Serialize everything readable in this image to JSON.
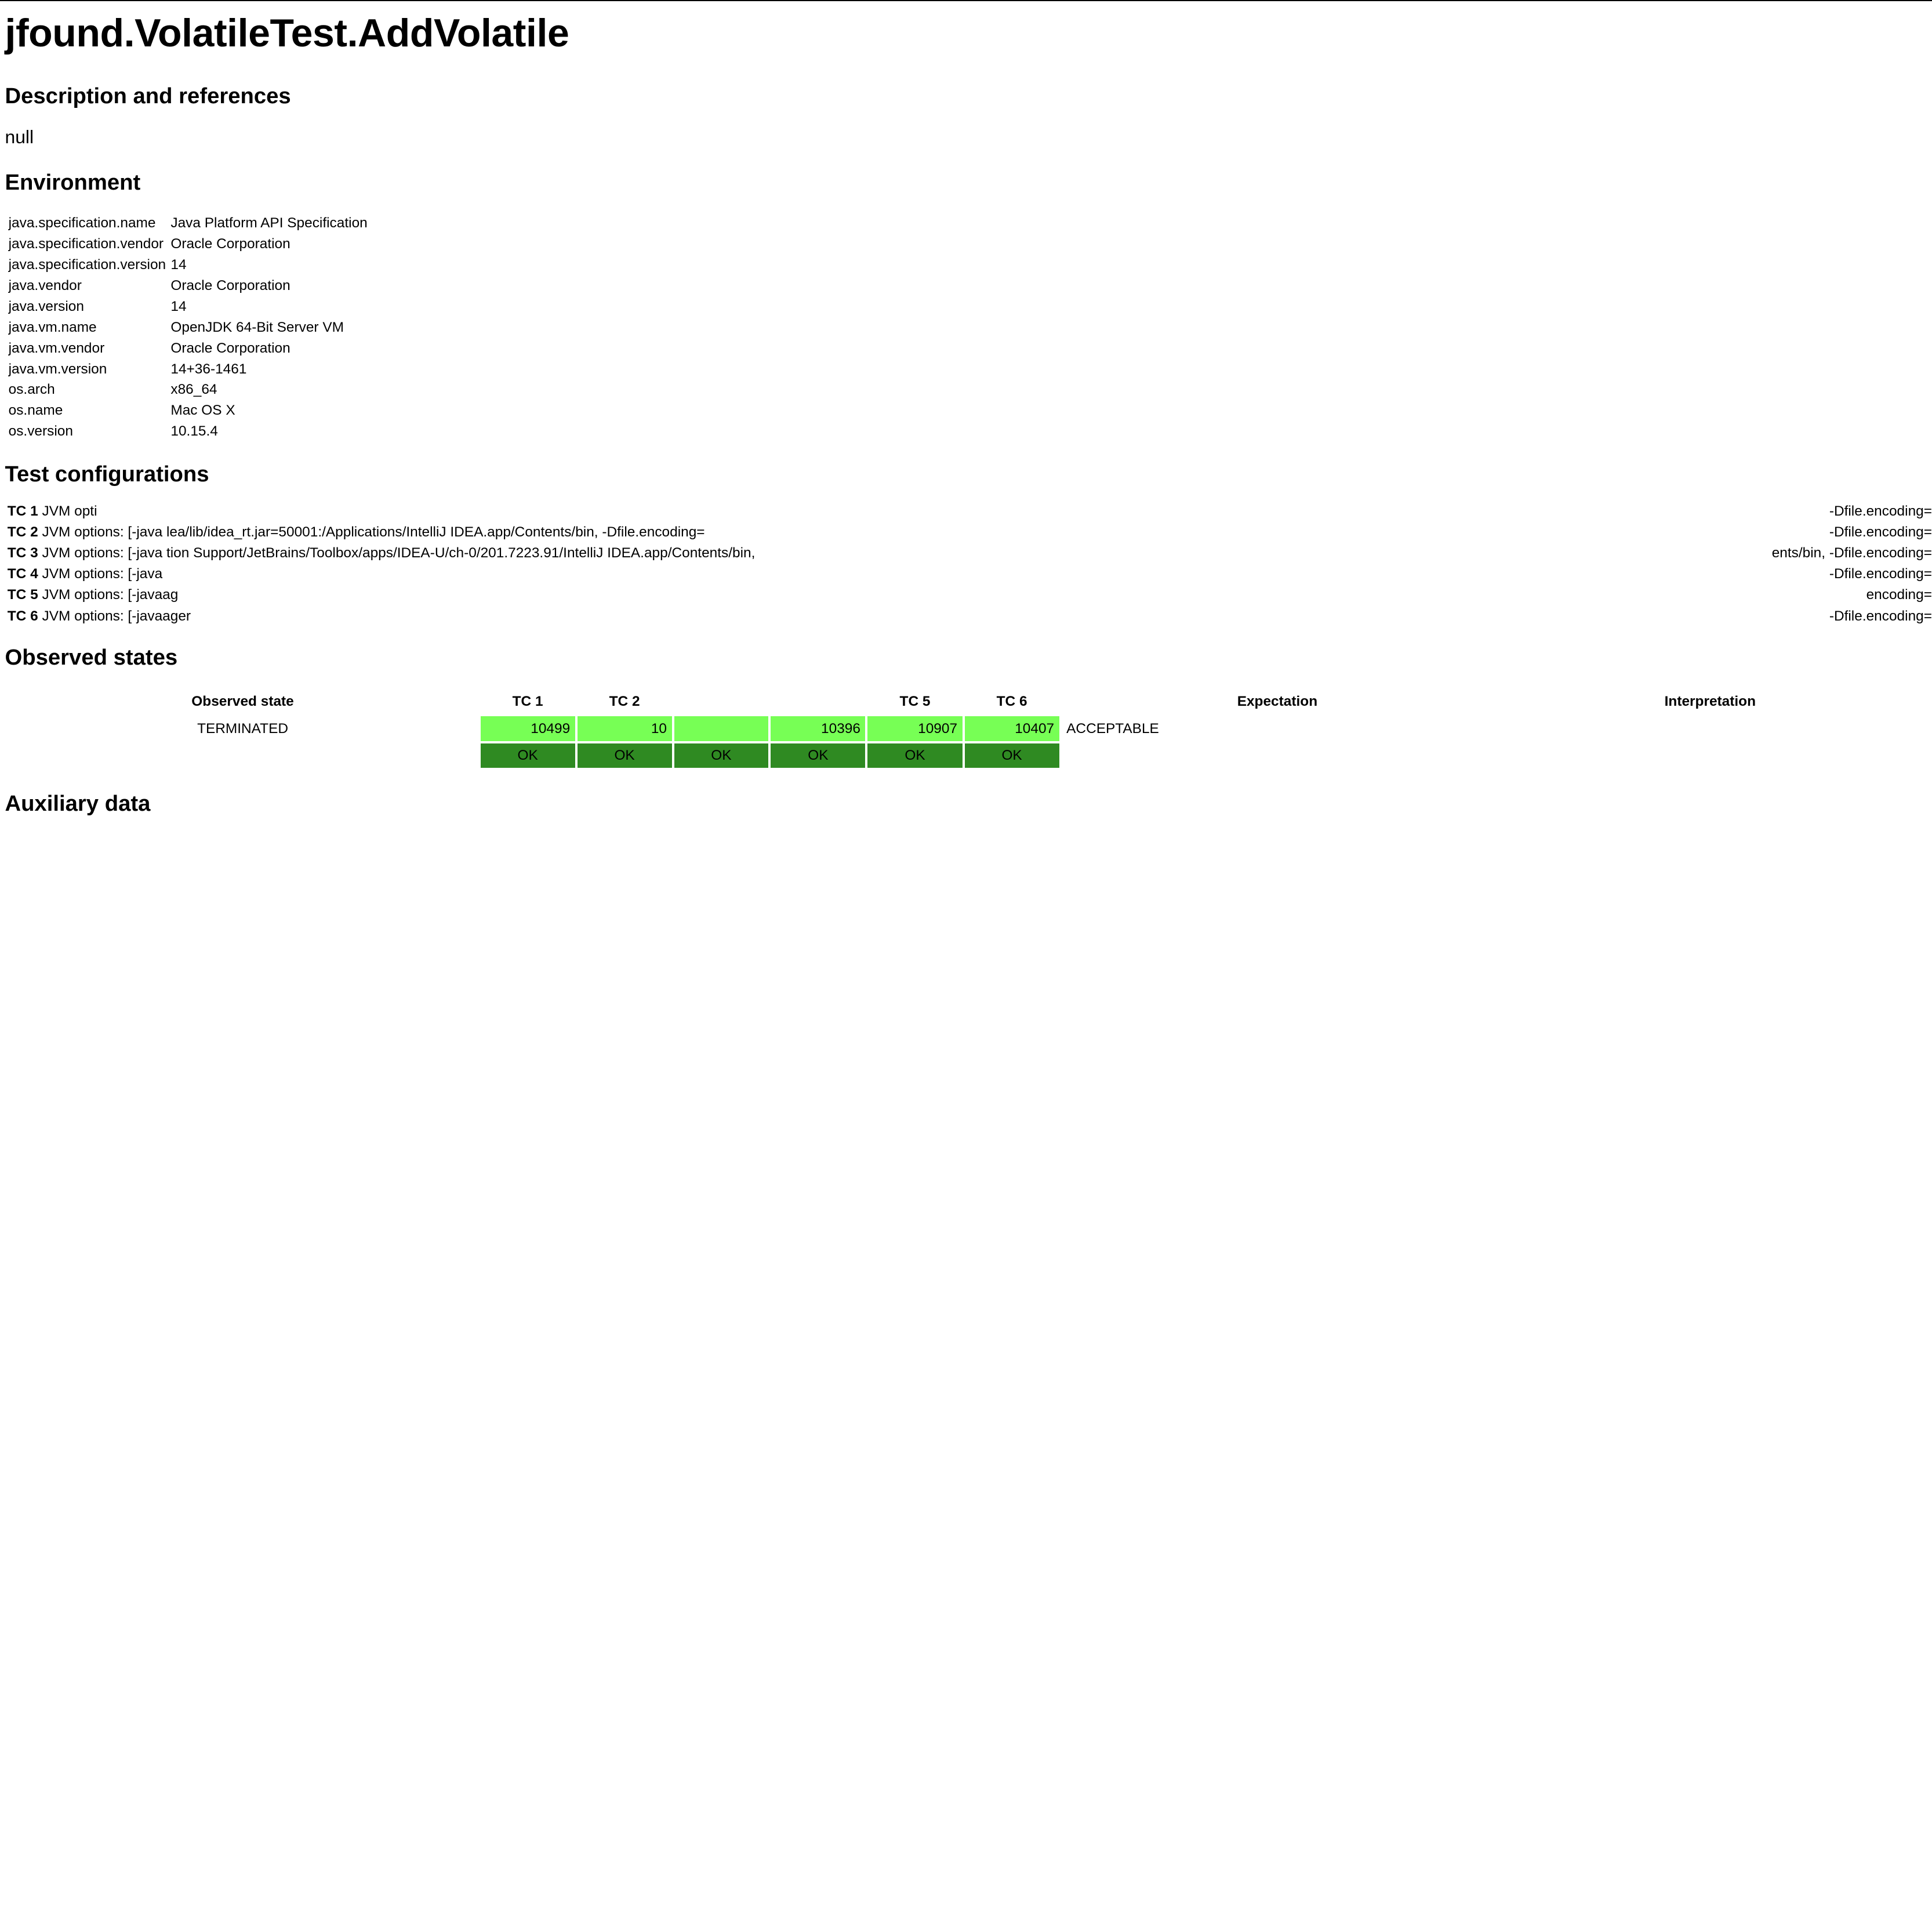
{
  "title": "jfound.VolatileTest.AddVolatile",
  "description": {
    "heading": "Description and references",
    "text": "null"
  },
  "environment": {
    "heading": "Environment",
    "rows": [
      {
        "key": "java.specification.name",
        "value": "Java Platform API Specification"
      },
      {
        "key": "java.specification.vendor",
        "value": "Oracle Corporation"
      },
      {
        "key": "java.specification.version",
        "value": "14"
      },
      {
        "key": "java.vendor",
        "value": "Oracle Corporation"
      },
      {
        "key": "java.version",
        "value": "14"
      },
      {
        "key": "java.vm.name",
        "value": "OpenJDK 64-Bit Server VM"
      },
      {
        "key": "java.vm.vendor",
        "value": "Oracle Corporation"
      },
      {
        "key": "java.vm.version",
        "value": "14+36-1461"
      },
      {
        "key": "os.arch",
        "value": "x86_64"
      },
      {
        "key": "os.name",
        "value": "Mac OS X"
      },
      {
        "key": "os.version",
        "value": "10.15.4"
      }
    ]
  },
  "test_configurations": {
    "heading": "Test configurations",
    "rows": [
      {
        "label": "TC 1",
        "options": "JVM opti",
        "middle": "",
        "tail": "-Dfile.encoding="
      },
      {
        "label": "TC 2",
        "options": "JVM options: [-java",
        "middle": "lea/lib/idea_rt.jar=50001:/Applications/IntelliJ IDEA.app/Contents/bin, -Dfile.encoding=",
        "tail": "-Dfile.encoding="
      },
      {
        "label": "TC 3",
        "options": "JVM options: [-java",
        "middle": "tion Support/JetBrains/Toolbox/apps/IDEA-U/ch-0/201.7223.91/IntelliJ IDEA.app/Contents/bin,",
        "tail": "ents/bin, -Dfile.encoding="
      },
      {
        "label": "TC 4",
        "options": "JVM options: [-java",
        "middle": "",
        "tail": "-Dfile.encoding="
      },
      {
        "label": "TC 5",
        "options": "JVM options: [-javaag",
        "middle": "",
        "tail": "encoding="
      },
      {
        "label": "TC 6",
        "options": "JVM options: [-javaager",
        "middle": "",
        "tail": "-Dfile.encoding="
      }
    ]
  },
  "observed_states": {
    "heading": "Observed states",
    "columns": {
      "state": "Observed state",
      "tc": [
        "TC 1",
        "TC 2",
        "",
        "",
        "TC 5",
        "TC 6"
      ],
      "expectation": "Expectation",
      "interpretation": "Interpretation"
    },
    "rows": [
      {
        "state": "TERMINATED",
        "counts": [
          "10499",
          "10",
          "",
          "10396",
          "10907",
          "10407"
        ],
        "expectation": "ACCEPTABLE",
        "interpretation": ""
      }
    ],
    "status": [
      "OK",
      "OK",
      "OK",
      "OK",
      "OK",
      "OK"
    ],
    "colors": {
      "count_cell": "#77ff55",
      "ok_cell": "#2f8a22"
    }
  },
  "auxiliary": {
    "heading": "Auxiliary data"
  }
}
